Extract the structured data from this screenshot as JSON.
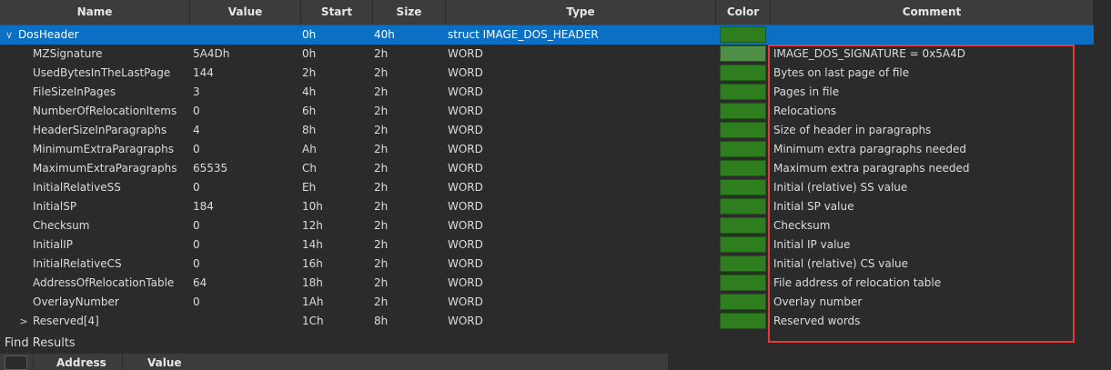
{
  "columns": {
    "name": "Name",
    "value": "Value",
    "start": "Start",
    "size": "Size",
    "type": "Type",
    "color": "Color",
    "comment": "Comment"
  },
  "rows": [
    {
      "name": "DosHeader",
      "value": "",
      "start": "0h",
      "size": "40h",
      "type": "struct IMAGE_DOS_HEADER",
      "comment": "",
      "toggle": "∨",
      "selected": true
    },
    {
      "name": "MZSignature",
      "value": "5A4Dh",
      "start": "0h",
      "size": "2h",
      "type": "WORD",
      "comment": "IMAGE_DOS_SIGNATURE = 0x5A4D",
      "toggle": ""
    },
    {
      "name": "UsedBytesInTheLastPage",
      "value": "144",
      "start": "2h",
      "size": "2h",
      "type": "WORD",
      "comment": "Bytes on last page of file",
      "toggle": ""
    },
    {
      "name": "FileSizeInPages",
      "value": "3",
      "start": "4h",
      "size": "2h",
      "type": "WORD",
      "comment": "Pages in file",
      "toggle": ""
    },
    {
      "name": "NumberOfRelocationItems",
      "value": "0",
      "start": "6h",
      "size": "2h",
      "type": "WORD",
      "comment": "Relocations",
      "toggle": ""
    },
    {
      "name": "HeaderSizeInParagraphs",
      "value": "4",
      "start": "8h",
      "size": "2h",
      "type": "WORD",
      "comment": "Size of header in paragraphs",
      "toggle": ""
    },
    {
      "name": "MinimumExtraParagraphs",
      "value": "0",
      "start": "Ah",
      "size": "2h",
      "type": "WORD",
      "comment": "Minimum extra paragraphs needed",
      "toggle": ""
    },
    {
      "name": "MaximumExtraParagraphs",
      "value": "65535",
      "start": "Ch",
      "size": "2h",
      "type": "WORD",
      "comment": "Maximum extra paragraphs needed",
      "toggle": ""
    },
    {
      "name": "InitialRelativeSS",
      "value": "0",
      "start": "Eh",
      "size": "2h",
      "type": "WORD",
      "comment": "Initial (relative) SS value",
      "toggle": ""
    },
    {
      "name": "InitialSP",
      "value": "184",
      "start": "10h",
      "size": "2h",
      "type": "WORD",
      "comment": "Initial SP value",
      "toggle": ""
    },
    {
      "name": "Checksum",
      "value": "0",
      "start": "12h",
      "size": "2h",
      "type": "WORD",
      "comment": "Checksum",
      "toggle": ""
    },
    {
      "name": "InitialIP",
      "value": "0",
      "start": "14h",
      "size": "2h",
      "type": "WORD",
      "comment": "Initial IP value",
      "toggle": ""
    },
    {
      "name": "InitialRelativeCS",
      "value": "0",
      "start": "16h",
      "size": "2h",
      "type": "WORD",
      "comment": "Initial (relative) CS value",
      "toggle": ""
    },
    {
      "name": "AddressOfRelocationTable",
      "value": "64",
      "start": "18h",
      "size": "2h",
      "type": "WORD",
      "comment": "File address of relocation table",
      "toggle": ""
    },
    {
      "name": "OverlayNumber",
      "value": "0",
      "start": "1Ah",
      "size": "2h",
      "type": "WORD",
      "comment": "Overlay number",
      "toggle": ""
    },
    {
      "name": "Reserved[4]",
      "value": "",
      "start": "1Ch",
      "size": "8h",
      "type": "WORD",
      "comment": "Reserved words",
      "toggle": ">"
    }
  ],
  "colors": {
    "selection": "#0b6fc4",
    "swatch": "#2e7d1e",
    "swatch_highlight": "#4f8f47",
    "annotation_box": "#e23b3b"
  },
  "find": {
    "title": "Find Results",
    "col_address": "Address",
    "col_value": "Value"
  }
}
